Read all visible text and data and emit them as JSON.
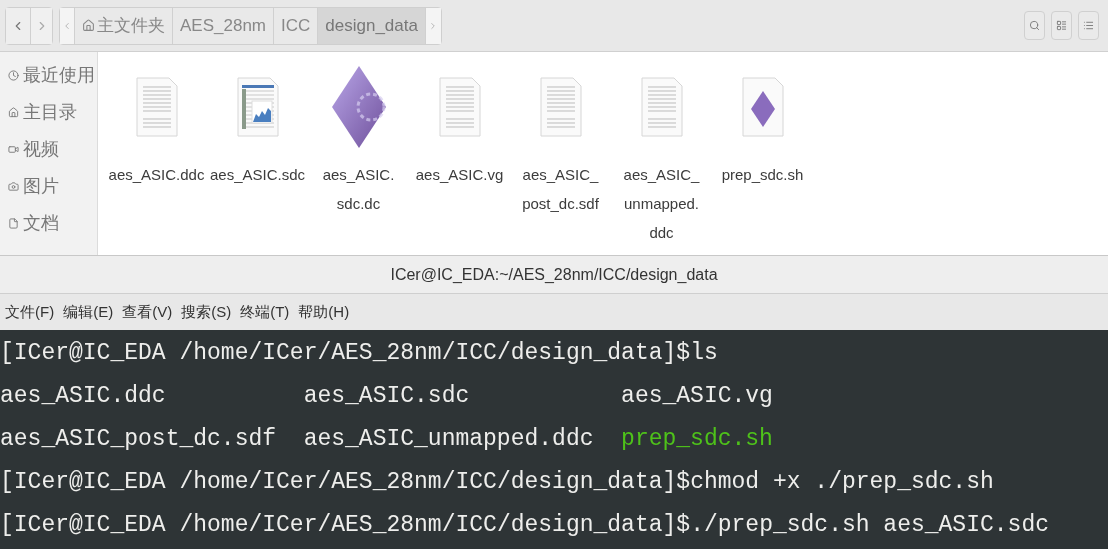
{
  "file_manager": {
    "breadcrumbs": [
      {
        "label": "主文件夹",
        "selected": false
      },
      {
        "label": "AES_28nm",
        "selected": false
      },
      {
        "label": "ICC",
        "selected": false
      },
      {
        "label": "design_data",
        "selected": true
      }
    ],
    "sidebar": {
      "items": [
        {
          "label": "最近使用"
        },
        {
          "label": "主目录"
        },
        {
          "label": "视频"
        },
        {
          "label": "图片"
        },
        {
          "label": "文档"
        }
      ]
    },
    "files": [
      {
        "kind": "text",
        "label_lines": [
          "aes_ASIC.ddc"
        ]
      },
      {
        "kind": "spreadsheet",
        "label_lines": [
          "aes_ASIC.sdc"
        ]
      },
      {
        "kind": "diamond",
        "label_lines": [
          "aes_ASIC.",
          "sdc.dc"
        ]
      },
      {
        "kind": "text",
        "label_lines": [
          "aes_ASIC.vg"
        ]
      },
      {
        "kind": "text",
        "label_lines": [
          "aes_ASIC_",
          "post_dc.sdf"
        ]
      },
      {
        "kind": "text",
        "label_lines": [
          "aes_ASIC_",
          "unmapped.",
          "ddc"
        ]
      },
      {
        "kind": "script",
        "label_lines": [
          "prep_sdc.sh"
        ]
      }
    ]
  },
  "terminal": {
    "title": "ICer@IC_EDA:~/AES_28nm/ICC/design_data",
    "menu": [
      "文件(F)",
      "编辑(E)",
      "查看(V)",
      "搜索(S)",
      "终端(T)",
      "帮助(H)"
    ],
    "lines": [
      {
        "kind": "prompt",
        "prompt": "[ICer@IC_EDA /home/ICer/AES_28nm/ICC/design_data]$",
        "command": "ls"
      },
      {
        "kind": "listing",
        "entries": [
          {
            "name": "aes_ASIC.ddc",
            "executable": false
          },
          {
            "name": "aes_ASIC.sdc",
            "executable": false
          },
          {
            "name": "aes_ASIC.vg",
            "executable": false
          }
        ]
      },
      {
        "kind": "listing",
        "entries": [
          {
            "name": "aes_ASIC_post_dc.sdf",
            "executable": false
          },
          {
            "name": "aes_ASIC_unmapped.ddc",
            "executable": false
          },
          {
            "name": "prep_sdc.sh",
            "executable": true
          }
        ]
      },
      {
        "kind": "prompt",
        "prompt": "[ICer@IC_EDA /home/ICer/AES_28nm/ICC/design_data]$",
        "command": "chmod +x ./prep_sdc.sh"
      },
      {
        "kind": "prompt",
        "prompt": "[ICer@IC_EDA /home/ICer/AES_28nm/ICC/design_data]$",
        "command": "./prep_sdc.sh aes_ASIC.sdc"
      }
    ]
  }
}
